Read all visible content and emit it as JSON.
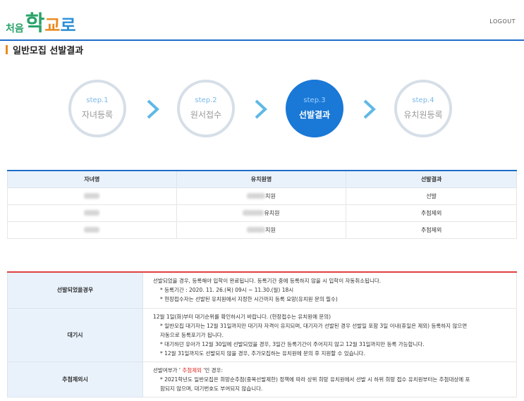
{
  "header": {
    "logo": {
      "part1": "처음",
      "part2": "학",
      "part3": "교",
      "part4": "로"
    },
    "logout": "LOGOUT"
  },
  "page_title": "일반모집 선발결과",
  "steps": [
    {
      "num": "step.1",
      "label": "자녀등록",
      "active": false
    },
    {
      "num": "step.2",
      "label": "원서접수",
      "active": false
    },
    {
      "num": "step.3",
      "label": "선발결과",
      "active": true
    },
    {
      "num": "step.4",
      "label": "유치원등록",
      "active": false
    }
  ],
  "results": {
    "headers": [
      "자녀명",
      "유치원명",
      "선발결과"
    ],
    "rows": [
      {
        "kinder_suffix": "치원",
        "result": "선발"
      },
      {
        "kinder_suffix": "유치원",
        "result": "추첨제외"
      },
      {
        "kinder_suffix": "치원",
        "result": "추첨제외"
      }
    ]
  },
  "info": {
    "selected": {
      "title": "선발되었을경우",
      "line1": "선발되었을 경우, 등록해야 입학이 완료됩니다. 등록기간 중에 등록하지 않을 시 입학이 자동취소됩니다.",
      "line2": "* 등록기간 : 2020. 11. 26.(목) 09시 ~ 11.30.(월) 18시",
      "line3": "* 현장접수자는 선발된 유치원에서 지정한 시간까지 등록 요망(유치원 문의 필수)"
    },
    "waiting": {
      "title": "대기시",
      "line1": "12월 1일(화)부터 대기순위를 확인하시기 바랍니다. (현장접수는 유치원에 문의)",
      "line2": "* 일반모집 대기자는 12월 31일까지만 대기자 자격이 유지되며, 대기자가 선발된 경우 선발일 포함 3일 이내(휴일은 제외) 등록하지 않으면",
      "line2b": "자동으로 등록포기가 됩니다.",
      "line3": "* 대기하던 유아가 12월 30일에 선발되었을 경우, 3일간 등록기간이 주어지지 않고 12월 31일까지만 등록 가능합니다.",
      "line4": "* 12월 31일까지도 선발되지 않을 경우, 추가모집하는 유치원에 문의 후 지원할 수 있습니다."
    },
    "excluded": {
      "title": "추첨제외시",
      "line1_pre": "선발여부가 ' ",
      "line1_red": "추첨제외",
      "line1_post": " '인 경우:",
      "line2": "* 2021학년도 일반모집은 희망순추첨(중복선발제한) 정책에 따라 상위 희망 유치원에서 선발 시 하위 희망 접수 유치원부터는 추첨대상에 포",
      "line2b": "함되지 않으며, 대기번호도 부여되지 않습니다."
    }
  },
  "colors": {
    "primary": "#1a78d6",
    "accent_orange": "#e98a1f",
    "accent_red": "#e04040",
    "logo_green": "#2aa36b"
  }
}
